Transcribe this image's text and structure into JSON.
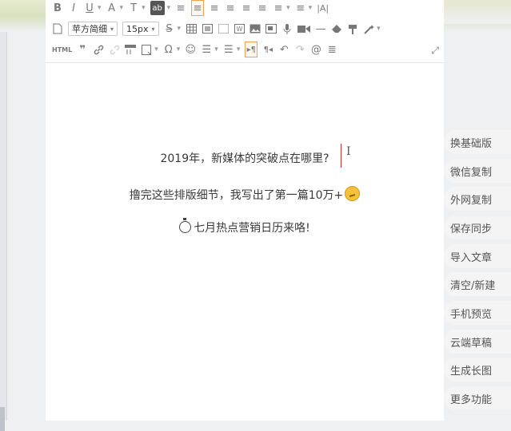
{
  "toolbar": {
    "row1": [
      "B",
      "I",
      "U",
      "A",
      "T",
      "ab",
      "≡",
      "≡",
      "≡",
      "≡",
      "≡",
      "≡",
      "≡",
      "≡",
      "≡",
      "≡",
      "|A|"
    ],
    "font_family": "苹方简细",
    "font_size": "15px",
    "html_label": "HTML"
  },
  "content": {
    "line1": "2019年，新媒体的突破点在哪里?",
    "line2": "撸完这些排版细节，我写出了第一篇10万+",
    "line3": "七月热点营销日历来咯!"
  },
  "side_menu": [
    "换基础版",
    "微信复制",
    "外网复制",
    "保存同步",
    "导入文章",
    "清空/新建",
    "手机预览",
    "云端草稿",
    "生成长图",
    "更多功能"
  ],
  "colors": {
    "accent": "#f0a050",
    "caret": "#c0392b",
    "text": "#3a3a3a"
  }
}
